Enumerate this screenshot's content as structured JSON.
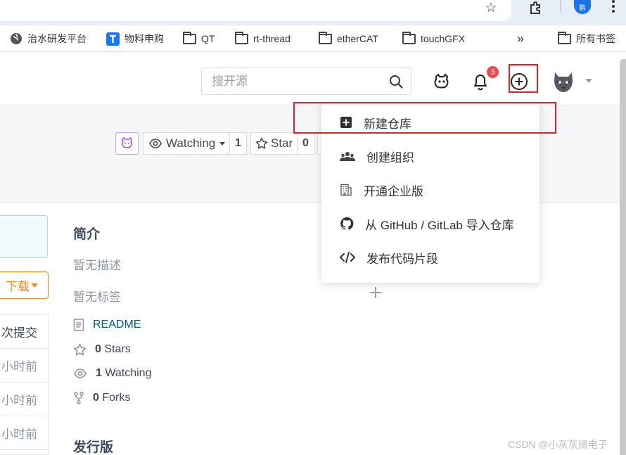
{
  "browser": {
    "profile_label": "鹏",
    "bookmarks": [
      {
        "label": "治水研发平台",
        "icon": "globe-icon"
      },
      {
        "label": "物料申购",
        "icon": "tapd-icon"
      },
      {
        "label": "QT",
        "icon": "folder-icon"
      },
      {
        "label": "rt-thread",
        "icon": "folder-icon"
      },
      {
        "label": "etherCAT",
        "icon": "folder-icon"
      },
      {
        "label": "touchGFX",
        "icon": "folder-icon"
      },
      {
        "label": "»",
        "icon": "overflow-icon"
      },
      {
        "label": "所有书签",
        "icon": "folder-icon"
      }
    ]
  },
  "header": {
    "search_placeholder": "搜开源",
    "notification_count": "3",
    "accent": "#e0222a"
  },
  "repo_actions": {
    "watch_label": "Watching",
    "watch_count": "1",
    "star_label": "Star",
    "star_count": "0"
  },
  "left_column": {
    "download_label": "下载",
    "commits_label": "次提交",
    "rows": [
      "小时前",
      "小时前",
      "小时前"
    ]
  },
  "about": {
    "intro_title": "简介",
    "no_description": "暂无描述",
    "no_tags": "暂无标签",
    "readme_label": "README",
    "stars_count": "0",
    "stars_label": "Stars",
    "watching_count": "1",
    "watching_label": "Watching",
    "forks_count": "0",
    "forks_label": "Forks",
    "releases_title": "发行版"
  },
  "create_menu": {
    "items": [
      {
        "label": "新建仓库",
        "icon": "plus-square-icon"
      },
      {
        "label": "创建组织",
        "icon": "group-icon"
      },
      {
        "label": "开通企业版",
        "icon": "building-icon"
      },
      {
        "label": "从 GitHub / GitLab 导入仓库",
        "icon": "github-icon"
      },
      {
        "label": "发布代码片段",
        "icon": "code-icon"
      }
    ]
  },
  "watermark": "CSDN @小灰灰搞电子"
}
